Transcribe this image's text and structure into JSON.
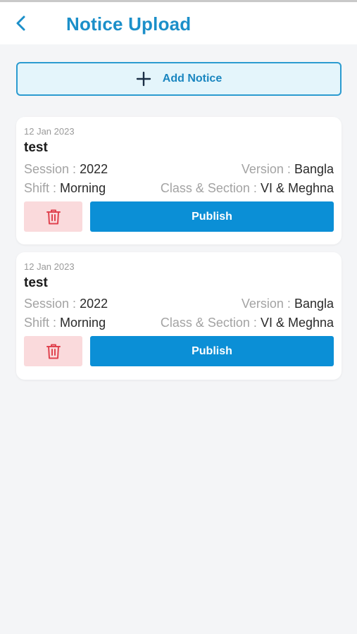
{
  "header": {
    "title": "Notice Upload"
  },
  "add_notice": {
    "label": "Add Notice"
  },
  "notices": [
    {
      "date": "12 Jan 2023",
      "title": "test",
      "session_label": "Session :",
      "session": "2022",
      "version_label": "Version :",
      "version": "Bangla",
      "shift_label": "Shift :",
      "shift": "Morning",
      "class_label": "Class & Section :",
      "class_section": "VI & Meghna",
      "publish_label": "Publish"
    },
    {
      "date": "12 Jan 2023",
      "title": "test",
      "session_label": "Session :",
      "session": "2022",
      "version_label": "Version :",
      "version": "Bangla",
      "shift_label": "Shift :",
      "shift": "Morning",
      "class_label": "Class & Section :",
      "class_section": "VI & Meghna",
      "publish_label": "Publish"
    }
  ],
  "colors": {
    "accent": "#1b8fc9",
    "publish": "#0b8fd6",
    "delete_bg": "#fadadc",
    "delete_icon": "#e0434f"
  }
}
